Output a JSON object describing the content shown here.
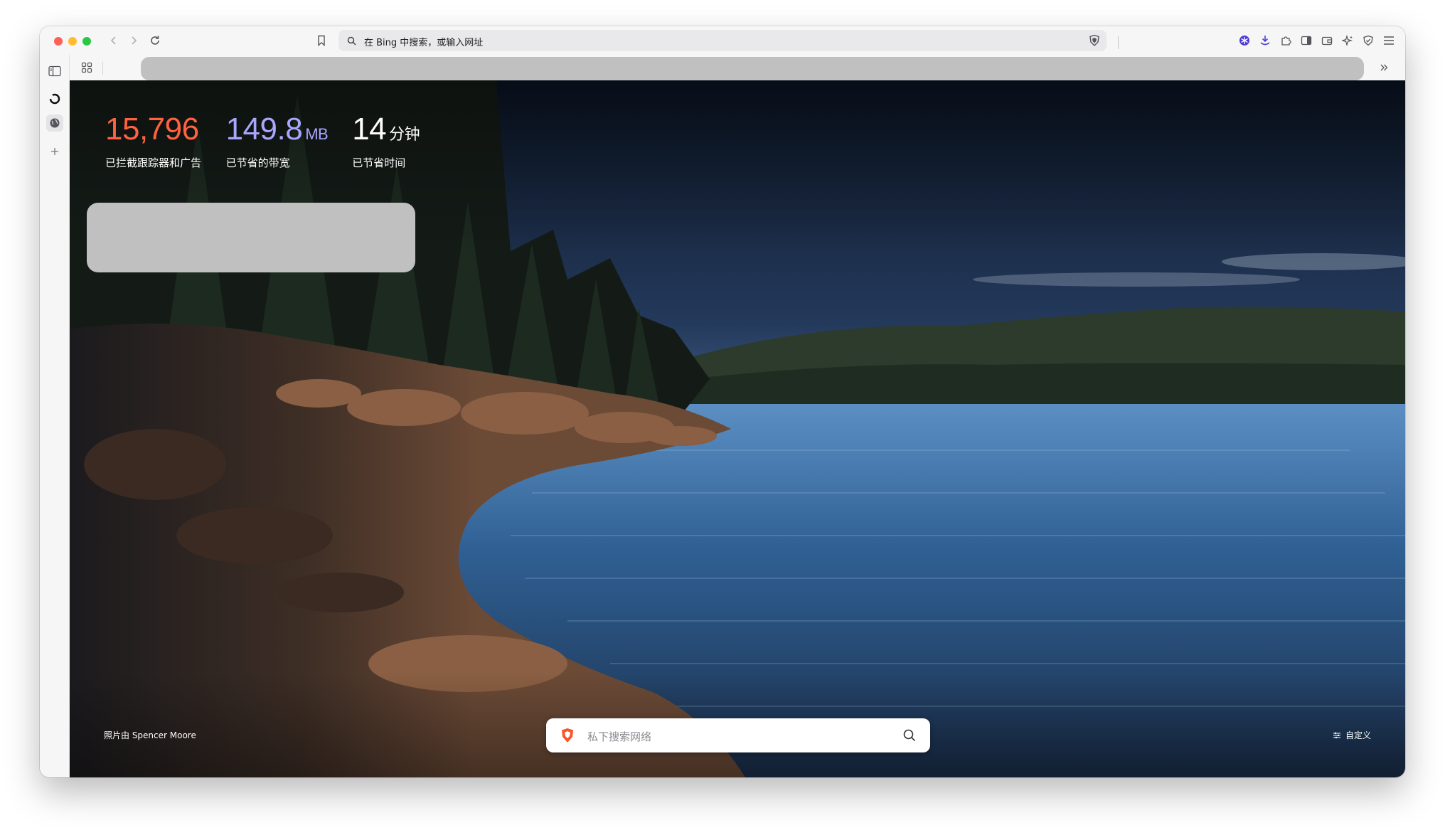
{
  "toolbar": {
    "url_placeholder": "在 Bing 中搜索，或输入网址"
  },
  "stats": [
    {
      "value": "15,796",
      "unit": "",
      "label": "已拦截跟踪器和广告",
      "color": "#ff6240"
    },
    {
      "value": "149.8",
      "unit": "MB",
      "label": "已节省的带宽",
      "color": "#a9a6ff"
    },
    {
      "value": "14",
      "unit": "分钟",
      "label": "已节省时间",
      "color": "#ffffff"
    }
  ],
  "photo_credit": "照片由 Spencer Moore",
  "search": {
    "placeholder": "私下搜索网络"
  },
  "customize_label": "自定义",
  "colors": {
    "brave_orange": "#fb542b",
    "chrome_bg": "#f6f6f7"
  }
}
